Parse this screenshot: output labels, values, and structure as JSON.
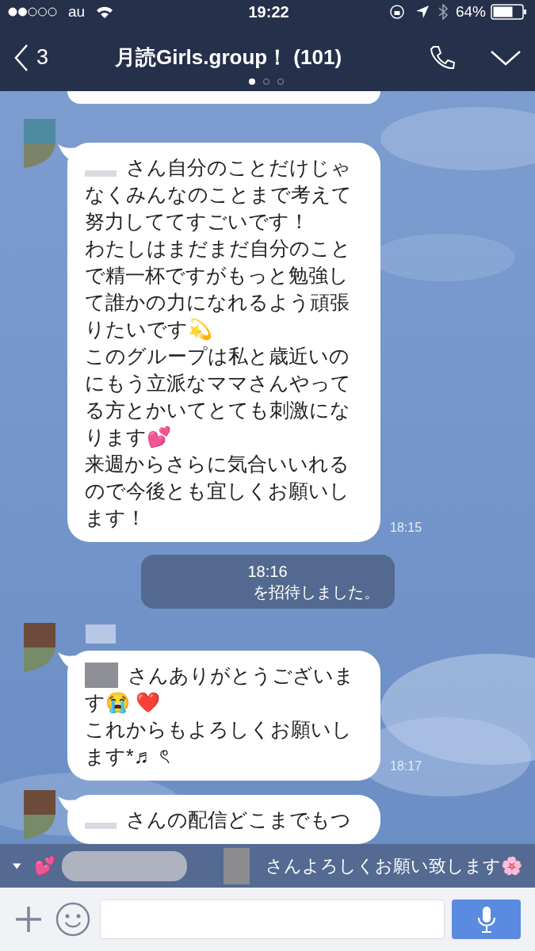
{
  "status_bar": {
    "carrier": "au",
    "time": "19:22",
    "battery": "64%"
  },
  "header": {
    "back_count": "3",
    "title": "月読Girls.group！ (101)",
    "pages": [
      {
        "selected": true
      },
      {
        "selected": false
      },
      {
        "selected": false
      }
    ]
  },
  "messages": [
    {
      "kind": "incoming",
      "name_redacted": false,
      "lines": [
        "さん自分のことだけじゃ",
        "なくみんなのことまで考えて",
        "努力しててすごいです！",
        "わたしはまだまだ自分のこと",
        "で精一杯ですがもっと勉強し",
        "て誰かの力になれるよう頑張",
        "りたいです💫",
        "このグループは私と歳近いの",
        "にもう立派なママさんやって",
        "る方とかいてとても刺激にな",
        "ります💕",
        "来週からさらに気合いいれる",
        "ので今後とも宜しくお願いし",
        "ます！"
      ],
      "time": "18:15"
    },
    {
      "kind": "system",
      "time": "18:16",
      "text": "を招待しました。"
    },
    {
      "kind": "incoming",
      "name_redacted": true,
      "lines": [
        "さんありがとうございま",
        "す😭 ❤️",
        "これからもよろしくお願いし",
        "ます*♬ ৎ"
      ],
      "time": "18:17"
    },
    {
      "kind": "incoming",
      "name_redacted": false,
      "lines": [
        "さんの配信どこまでもつ"
      ]
    }
  ],
  "notification": {
    "emoji": "💕",
    "text": "さんよろしくお願い致します🌸"
  }
}
